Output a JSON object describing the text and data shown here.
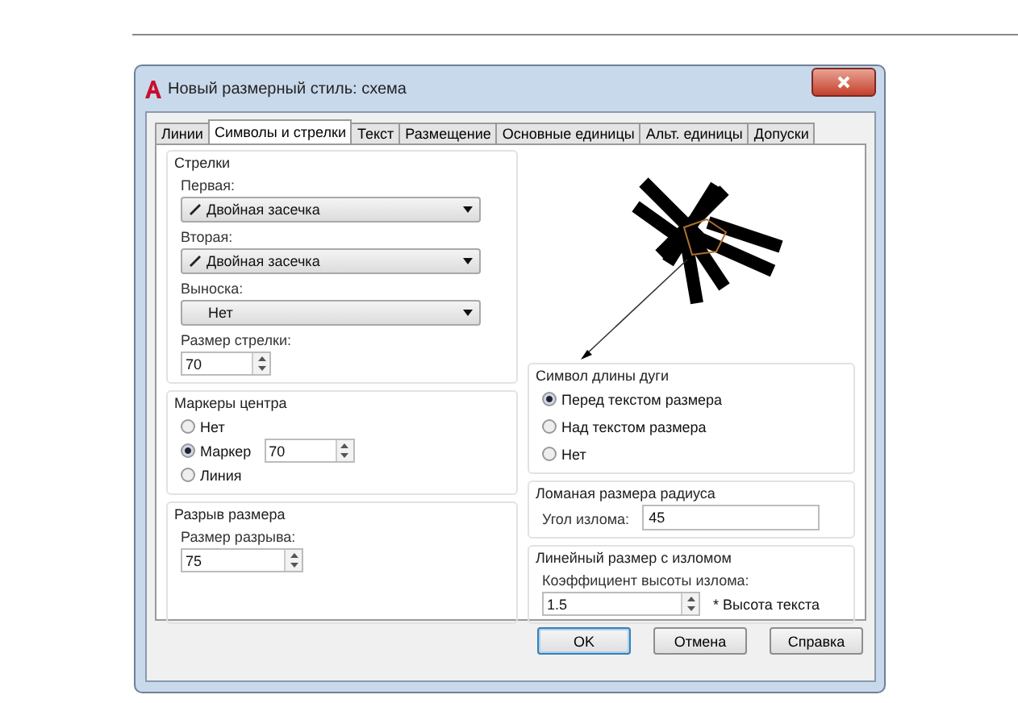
{
  "window": {
    "title": "Новый размерный стиль: схема"
  },
  "tabs": [
    {
      "label": "Линии",
      "selected": false
    },
    {
      "label": "Символы и стрелки",
      "selected": true
    },
    {
      "label": "Текст",
      "selected": false
    },
    {
      "label": "Размещение",
      "selected": false
    },
    {
      "label": "Основные единицы",
      "selected": false
    },
    {
      "label": "Альт. единицы",
      "selected": false
    },
    {
      "label": "Допуски",
      "selected": false
    }
  ],
  "arrows": {
    "title": "Стрелки",
    "dropdowns": [
      {
        "label": "Первая:",
        "value": "Двойная засечка",
        "kind": "symbol"
      },
      {
        "label": "Вторая:",
        "value": "Двойная засечка",
        "kind": "symbol"
      },
      {
        "label": "Выноска:",
        "value": "Нет",
        "kind": "plain"
      }
    ],
    "arrow_size": {
      "label": "Размер стрелки:",
      "value": "70"
    }
  },
  "center_marks": {
    "title": "Маркеры центра",
    "options": [
      {
        "label": "Нет",
        "selected": false
      },
      {
        "label": "Маркер",
        "selected": true
      },
      {
        "label": "Линия",
        "selected": false
      }
    ],
    "size": "70"
  },
  "dimension_break": {
    "title": "Разрыв размера",
    "label": "Размер разрыва:",
    "value": "75"
  },
  "arc_length_symbol": {
    "title": "Символ длины дуги",
    "options": [
      {
        "label": "Перед текстом размера",
        "selected": true
      },
      {
        "label": "Над текстом размера",
        "selected": false
      },
      {
        "label": "Нет",
        "selected": false
      }
    ]
  },
  "radius_jog": {
    "title": "Ломаная размера радиуса",
    "label": "Угол излома:",
    "value": "45"
  },
  "linear_jog": {
    "title": "Линейный размер с изломом",
    "label": "Коэффициент высоты излома:",
    "value": "1.5",
    "suffix": "* Высота текста"
  },
  "buttons": [
    {
      "label": "OK",
      "default": true
    },
    {
      "label": "Отмена",
      "default": false
    },
    {
      "label": "Справка",
      "default": false
    }
  ]
}
